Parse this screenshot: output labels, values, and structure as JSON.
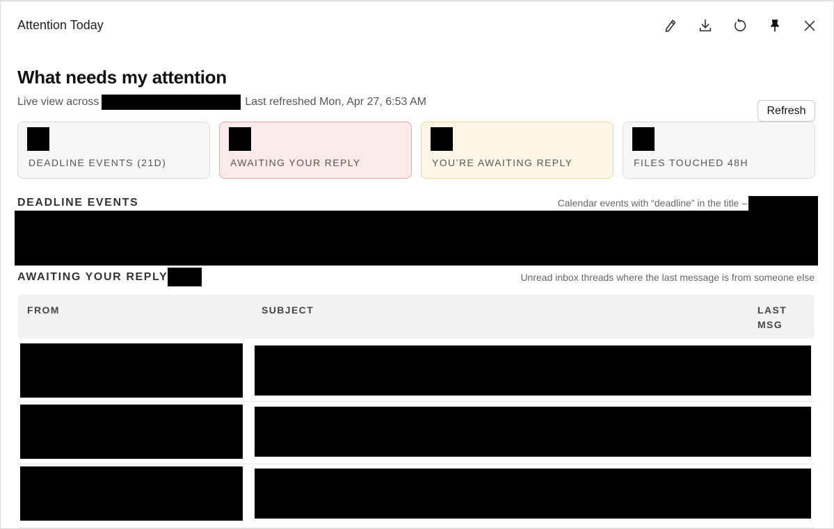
{
  "window": {
    "title": "Attention Today",
    "toolbar": {
      "edit_icon": "pencil-icon",
      "download_icon": "download-icon",
      "reload_icon": "refresh-icon",
      "pin_icon": "pin-icon",
      "close_icon": "close-icon"
    }
  },
  "header": {
    "title": "What needs my attention",
    "live_view_prefix": "Live view across",
    "last_refreshed": "Last refreshed Mon, Apr 27, 6:53 AM",
    "refresh_button": "Refresh"
  },
  "summary_cards": [
    {
      "label": "DEADLINE EVENTS (21D)",
      "accent": "#f6f6f6"
    },
    {
      "label": "AWAITING YOUR REPLY",
      "accent": "#fbeaea"
    },
    {
      "label": "YOU’RE AWAITING REPLY",
      "accent": "#fdf6e6"
    },
    {
      "label": "FILES TOUCHED 48H",
      "accent": "#f6f6f6"
    }
  ],
  "deadline_section": {
    "title": "DEADLINE EVENTS",
    "note": "Calendar events with “deadline” in the title –"
  },
  "reply_section": {
    "title": "AWAITING YOUR REPLY",
    "note": "Unread inbox threads where the last message is from someone else",
    "columns": {
      "from": "FROM",
      "subject": "SUBJECT",
      "last_msg_line1": "LAST",
      "last_msg_line2": "MSG"
    }
  },
  "colors": {
    "reply_card_border": "#eaa4a4",
    "waiting_card_border": "#f0d49b",
    "redaction": "#000000"
  }
}
